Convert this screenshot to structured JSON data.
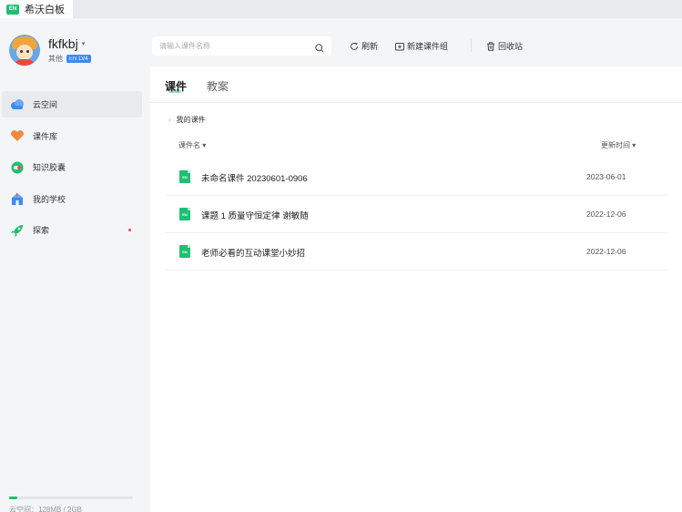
{
  "app": {
    "logo_text": "EN",
    "title": "希沃白板"
  },
  "profile": {
    "username": "fkfkbj",
    "caret": "▾",
    "role": "其他",
    "badge_icon": "EN",
    "level": "LV4"
  },
  "sidebar": {
    "items": [
      {
        "label": "云空间",
        "icon": "cloud-icon",
        "active": true
      },
      {
        "label": "课件库",
        "icon": "heart-library-icon",
        "active": false
      },
      {
        "label": "知识胶囊",
        "icon": "capsule-icon",
        "active": false
      },
      {
        "label": "我的学校",
        "icon": "school-icon",
        "active": false
      },
      {
        "label": "探索",
        "icon": "rocket-icon",
        "active": false,
        "has_dot": true
      }
    ],
    "storage": {
      "text": "云空间：128MB / 2GB",
      "used_fraction": 0.0625
    }
  },
  "toolbar": {
    "search_placeholder": "请输入课件名称",
    "refresh_label": "刷新",
    "new_group_label": "新建课件组",
    "recycle_label": "回收站"
  },
  "tabs": [
    {
      "label": "课件",
      "active": true
    },
    {
      "label": "教案",
      "active": false
    }
  ],
  "breadcrumb": {
    "chevron": "‹",
    "label": "我的课件"
  },
  "table": {
    "col_name": "课件名 ▾",
    "col_date": "更新时间 ▾",
    "rows": [
      {
        "icon": "EN",
        "name": "未命名课件 20230601-0906",
        "date": "2023-06-01"
      },
      {
        "icon": "EN",
        "name": "课题 1 质量守恒定律 谢敏随",
        "date": "2022-12-06"
      },
      {
        "icon": "EN",
        "name": "老师必看的互动课堂小妙招",
        "date": "2022-12-06"
      }
    ]
  },
  "colors": {
    "accent": "#1fbf73",
    "badge": "#3d8bf0",
    "dot": "#f0463e"
  }
}
